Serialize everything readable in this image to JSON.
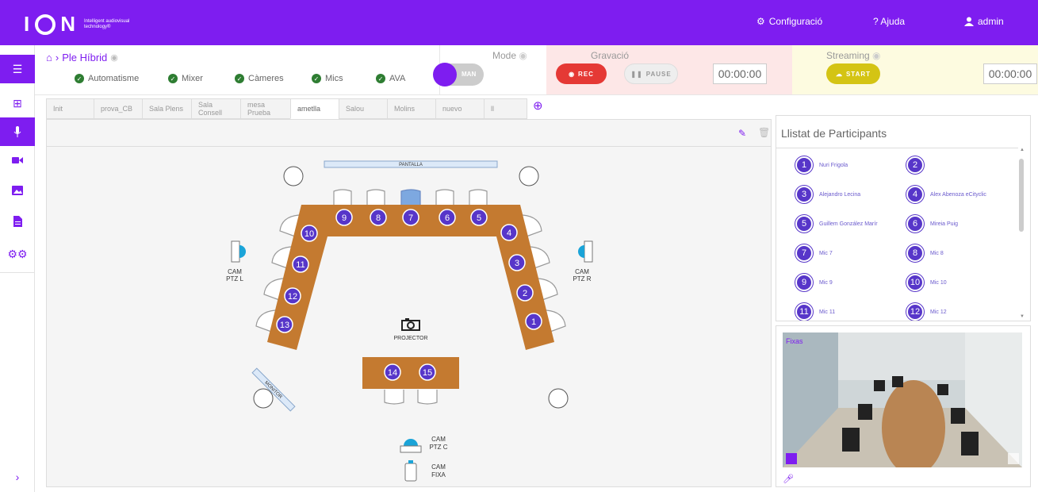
{
  "brand": {
    "logo_part1": "I",
    "logo_part2": "N",
    "tagline": "Intelligent audiovisual technology®"
  },
  "topnav": {
    "config": "Configuració",
    "help": "? Ajuda",
    "user": "admin"
  },
  "header": {
    "breadcrumb": "Ple Híbrid",
    "status": [
      "Automatisme",
      "Mixer",
      "Càmeres",
      "Mics",
      "AVA"
    ]
  },
  "mode": {
    "title": "Mode",
    "value": "MAN"
  },
  "gravacio": {
    "title": "Gravació",
    "rec_label": "REC",
    "pause_label": "PAUSE",
    "timer": "00:00:00"
  },
  "streaming": {
    "title": "Streaming",
    "start_label": "START",
    "timer": "00:00:00"
  },
  "tabs": [
    "Init",
    "prova_CB",
    "Sala Plens",
    "Sala Consell",
    "mesa Prueba",
    "ametlla",
    "Salou",
    "Molins",
    "nuevo",
    "ll"
  ],
  "active_tab": "ametlla",
  "room": {
    "screen": "PANTALLA",
    "projector": "PROJECTOR",
    "monitor": "MONITOR",
    "cam_l": [
      "CAM",
      "PTZ L"
    ],
    "cam_r": [
      "CAM",
      "PTZ R"
    ],
    "cam_c": [
      "CAM",
      "PTZ C"
    ],
    "cam_fixa": [
      "CAM",
      "FIXA"
    ],
    "mics": [
      "1",
      "2",
      "3",
      "4",
      "5",
      "6",
      "7",
      "8",
      "9",
      "10",
      "11",
      "12",
      "13",
      "14",
      "15"
    ]
  },
  "participants": {
    "title": "Llistat de Participants",
    "items": [
      {
        "n": "1",
        "name": "Nuri Frigola"
      },
      {
        "n": "2",
        "name": ""
      },
      {
        "n": "3",
        "name": "Alejandro Lecina"
      },
      {
        "n": "4",
        "name": "Alex Abenoza eCityclic"
      },
      {
        "n": "5",
        "name": "Guillem González Marír"
      },
      {
        "n": "6",
        "name": "Mireia Puig"
      },
      {
        "n": "7",
        "name": "Mic 7"
      },
      {
        "n": "8",
        "name": "Mic 8"
      },
      {
        "n": "9",
        "name": "Mic 9"
      },
      {
        "n": "10",
        "name": "Mic 10"
      },
      {
        "n": "11",
        "name": "Mic 11"
      },
      {
        "n": "12",
        "name": "Mic 12"
      }
    ]
  },
  "video": {
    "label": "Fixas"
  },
  "colors": {
    "accent": "#7e1df0",
    "table": "#c47a30",
    "mic": "#5736c9",
    "rec": "#e53935",
    "start": "#d4c414"
  }
}
